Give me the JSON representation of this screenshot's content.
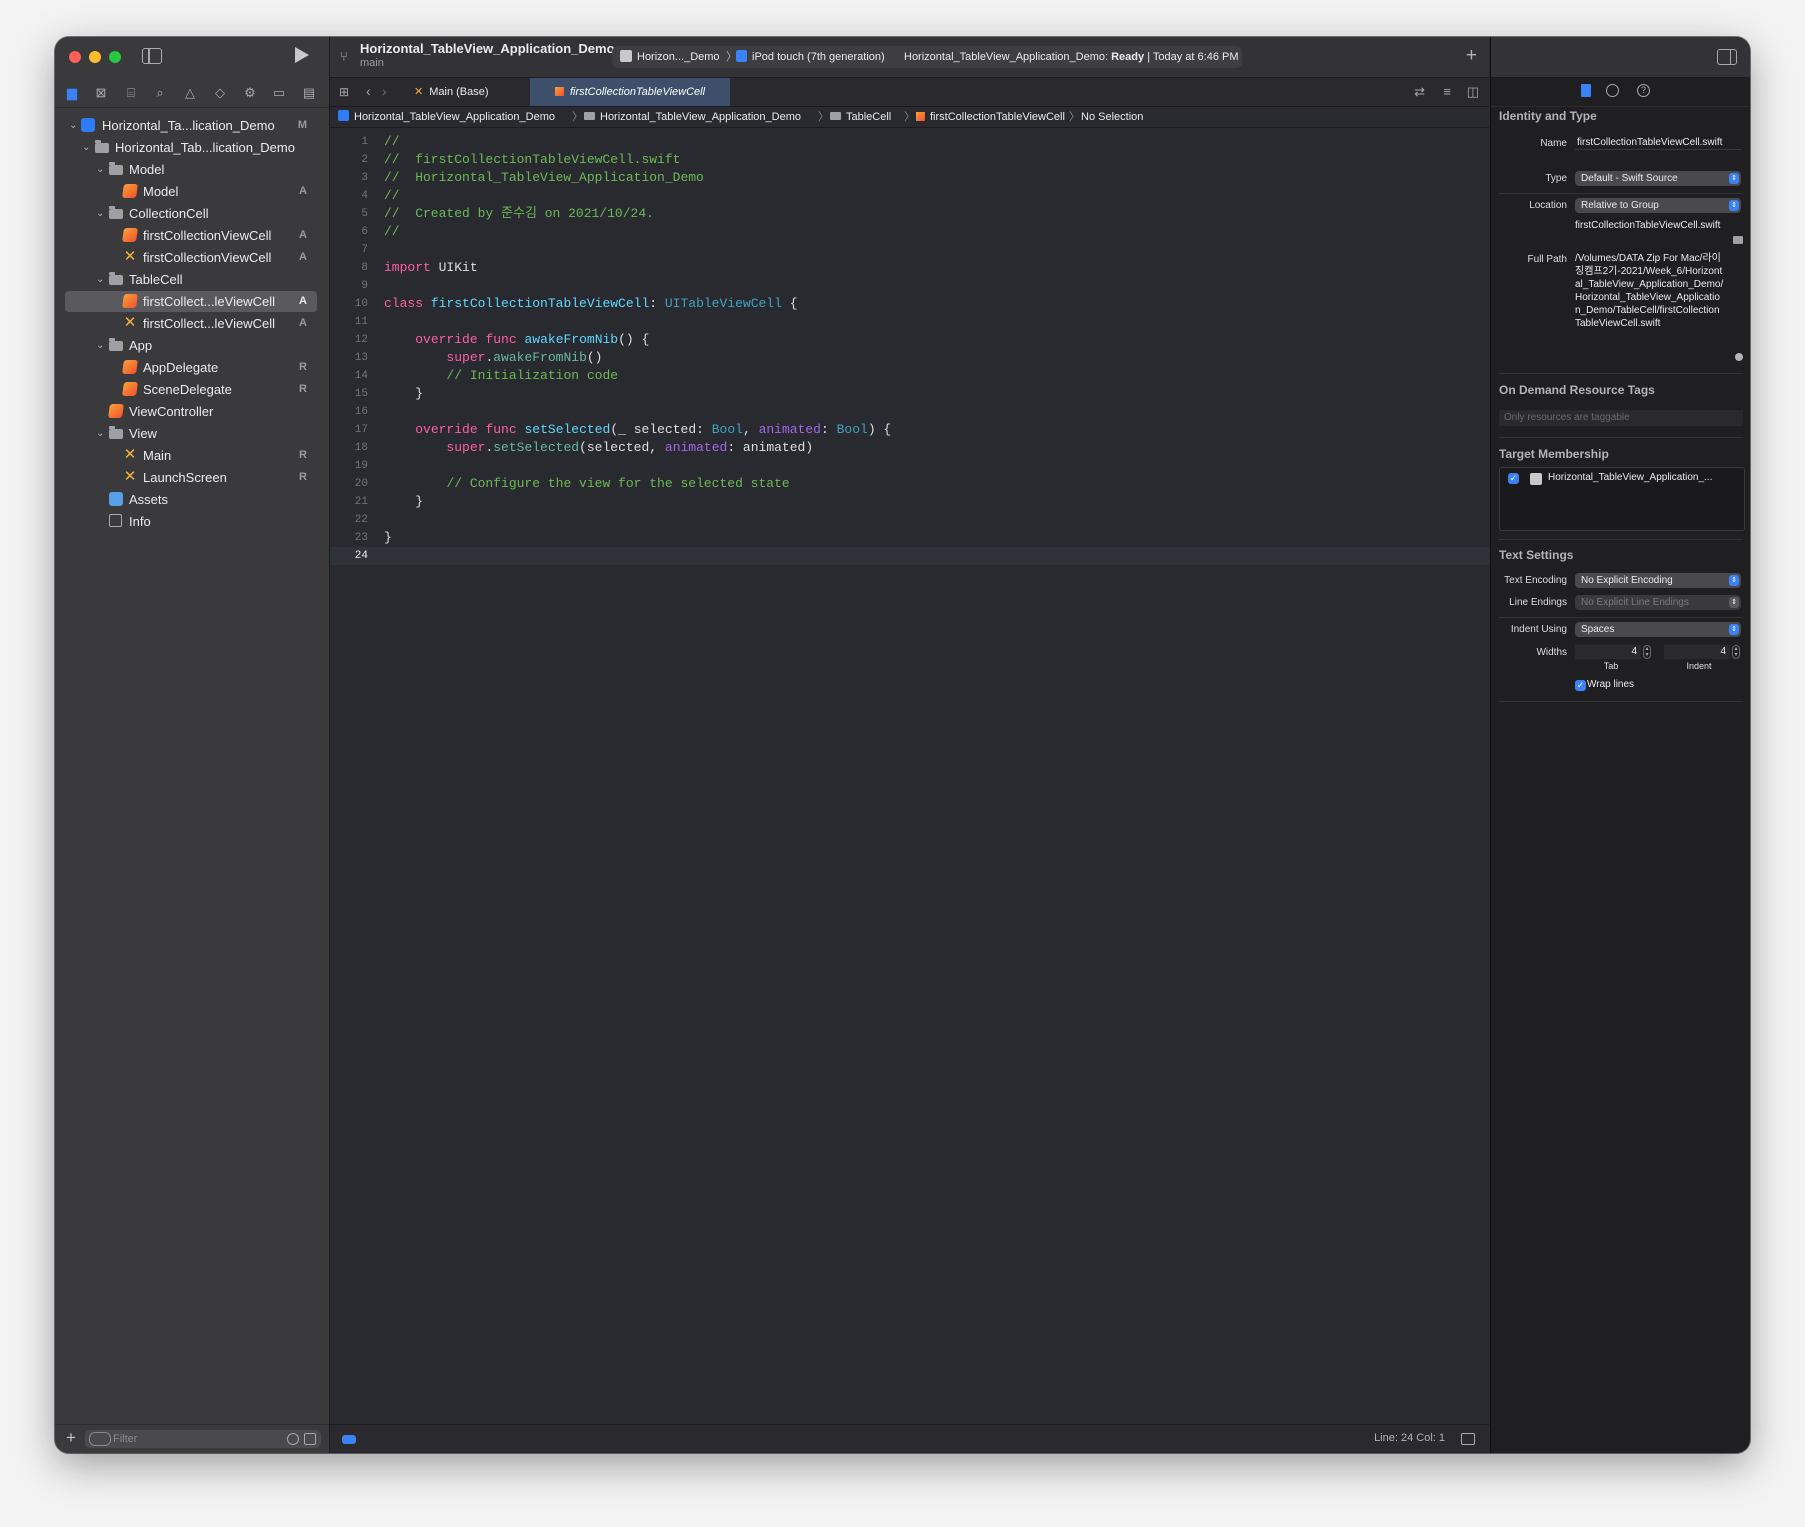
{
  "colors": {
    "accent": "#3b82f6",
    "editor_bg": "#292a30",
    "sidebar_bg": "#3a3a3c",
    "comment": "#6bba54",
    "keyword": "#fc5fa3",
    "type": "#5dd8ff"
  },
  "toolbar": {
    "project_title": "Horizontal_TableView_Application_Demo",
    "branch": "main",
    "scheme_target": "Horizon..._Demo",
    "scheme_sep": "〉",
    "device": "iPod touch (7th generation)",
    "status_prefix": "Horizontal_TableView_Application_Demo:",
    "status_state": "Ready",
    "status_time": "| Today at 6:46 PM"
  },
  "navigator": {
    "icons": [
      "folder-icon",
      "source-control-icon",
      "symbol-icon",
      "search-icon",
      "issue-icon",
      "test-icon",
      "debug-icon",
      "breakpoint-icon",
      "report-icon"
    ],
    "items": [
      {
        "label": "Horizontal_Ta...lication_Demo",
        "badge": "M",
        "icon": "project-icon"
      },
      {
        "label": "Horizontal_Tab...lication_Demo",
        "badge": "",
        "icon": "folder-icon"
      },
      {
        "label": "Model",
        "badge": "",
        "icon": "folder-icon"
      },
      {
        "label": "Model",
        "badge": "A",
        "icon": "swift-file-icon"
      },
      {
        "label": "CollectionCell",
        "badge": "",
        "icon": "folder-icon"
      },
      {
        "label": "firstCollectionViewCell",
        "badge": "A",
        "icon": "swift-file-icon"
      },
      {
        "label": "firstCollectionViewCell",
        "badge": "A",
        "icon": "xib-file-icon"
      },
      {
        "label": "TableCell",
        "badge": "",
        "icon": "folder-icon"
      },
      {
        "label": "firstCollect...leViewCell",
        "badge": "A",
        "icon": "swift-file-icon"
      },
      {
        "label": "firstCollect...leViewCell",
        "badge": "A",
        "icon": "xib-file-icon"
      },
      {
        "label": "App",
        "badge": "",
        "icon": "folder-icon"
      },
      {
        "label": "AppDelegate",
        "badge": "R",
        "icon": "swift-file-icon"
      },
      {
        "label": "SceneDelegate",
        "badge": "R",
        "icon": "swift-file-icon"
      },
      {
        "label": "ViewController",
        "badge": "",
        "icon": "swift-file-icon"
      },
      {
        "label": "View",
        "badge": "",
        "icon": "folder-icon"
      },
      {
        "label": "Main",
        "badge": "R",
        "icon": "xib-file-icon"
      },
      {
        "label": "LaunchScreen",
        "badge": "R",
        "icon": "xib-file-icon"
      },
      {
        "label": "Assets",
        "badge": "",
        "icon": "assets-icon"
      },
      {
        "label": "Info",
        "badge": "",
        "icon": "plist-icon"
      }
    ],
    "selected_index": 8,
    "filter_placeholder": "Filter"
  },
  "tabs": [
    {
      "label": "Main (Base)",
      "active": false
    },
    {
      "label": "firstCollectionTableViewCell",
      "active": true
    }
  ],
  "jumpbar": {
    "project": "Horizontal_TableView_Application_Demo",
    "group": "Horizontal_TableView_Application_Demo",
    "folder": "TableCell",
    "file": "firstCollectionTableViewCell",
    "selection": "No Selection",
    "sep": "〉"
  },
  "code": {
    "current_line": 24,
    "lines": [
      "//",
      "//  firstCollectionTableViewCell.swift",
      "//  Horizontal_TableView_Application_Demo",
      "//",
      "//  Created by 준수김 on 2021/10/24.",
      "//",
      "",
      "import UIKit",
      "",
      "class firstCollectionTableViewCell: UITableViewCell {",
      "",
      "    override func awakeFromNib() {",
      "        super.awakeFromNib()",
      "        // Initialization code",
      "    }",
      "",
      "    override func setSelected(_ selected: Bool, animated: Bool) {",
      "        super.setSelected(selected, animated: animated)",
      "",
      "        // Configure the view for the selected state",
      "    }",
      "",
      "}",
      ""
    ]
  },
  "statusbar": {
    "line_col": "Line: 24  Col: 1"
  },
  "inspector": {
    "identity": {
      "heading": "Identity and Type",
      "name_label": "Name",
      "name_value": "firstCollectionTableViewCell.swift",
      "type_label": "Type",
      "type_value": "Default - Swift Source",
      "location_label": "Location",
      "location_value": "Relative to Group",
      "location_file": "firstCollectionTableViewCell.swift",
      "fullpath_label": "Full Path",
      "fullpath_value": "/Volumes/DATA Zip For Mac/라이징캠프2기-2021/Week_6/Horizontal_TableView_Application_Demo/Horizontal_TableView_Application_Demo/TableCell/firstCollectionTableViewCell.swift"
    },
    "ondemand": {
      "heading": "On Demand Resource Tags",
      "placeholder": "Only resources are taggable"
    },
    "target": {
      "heading": "Target Membership",
      "item": "Horizontal_TableView_Application_...",
      "checked": true
    },
    "text_settings": {
      "heading": "Text Settings",
      "encoding_label": "Text Encoding",
      "encoding_value": "No Explicit Encoding",
      "line_endings_label": "Line Endings",
      "line_endings_value": "No Explicit Line Endings",
      "indent_label": "Indent Using",
      "indent_value": "Spaces",
      "widths_label": "Widths",
      "tab_value": "4",
      "indent_width_value": "4",
      "tab_label": "Tab",
      "indent_sub_label": "Indent",
      "wrap_label": "Wrap lines",
      "wrap_checked": true
    }
  }
}
